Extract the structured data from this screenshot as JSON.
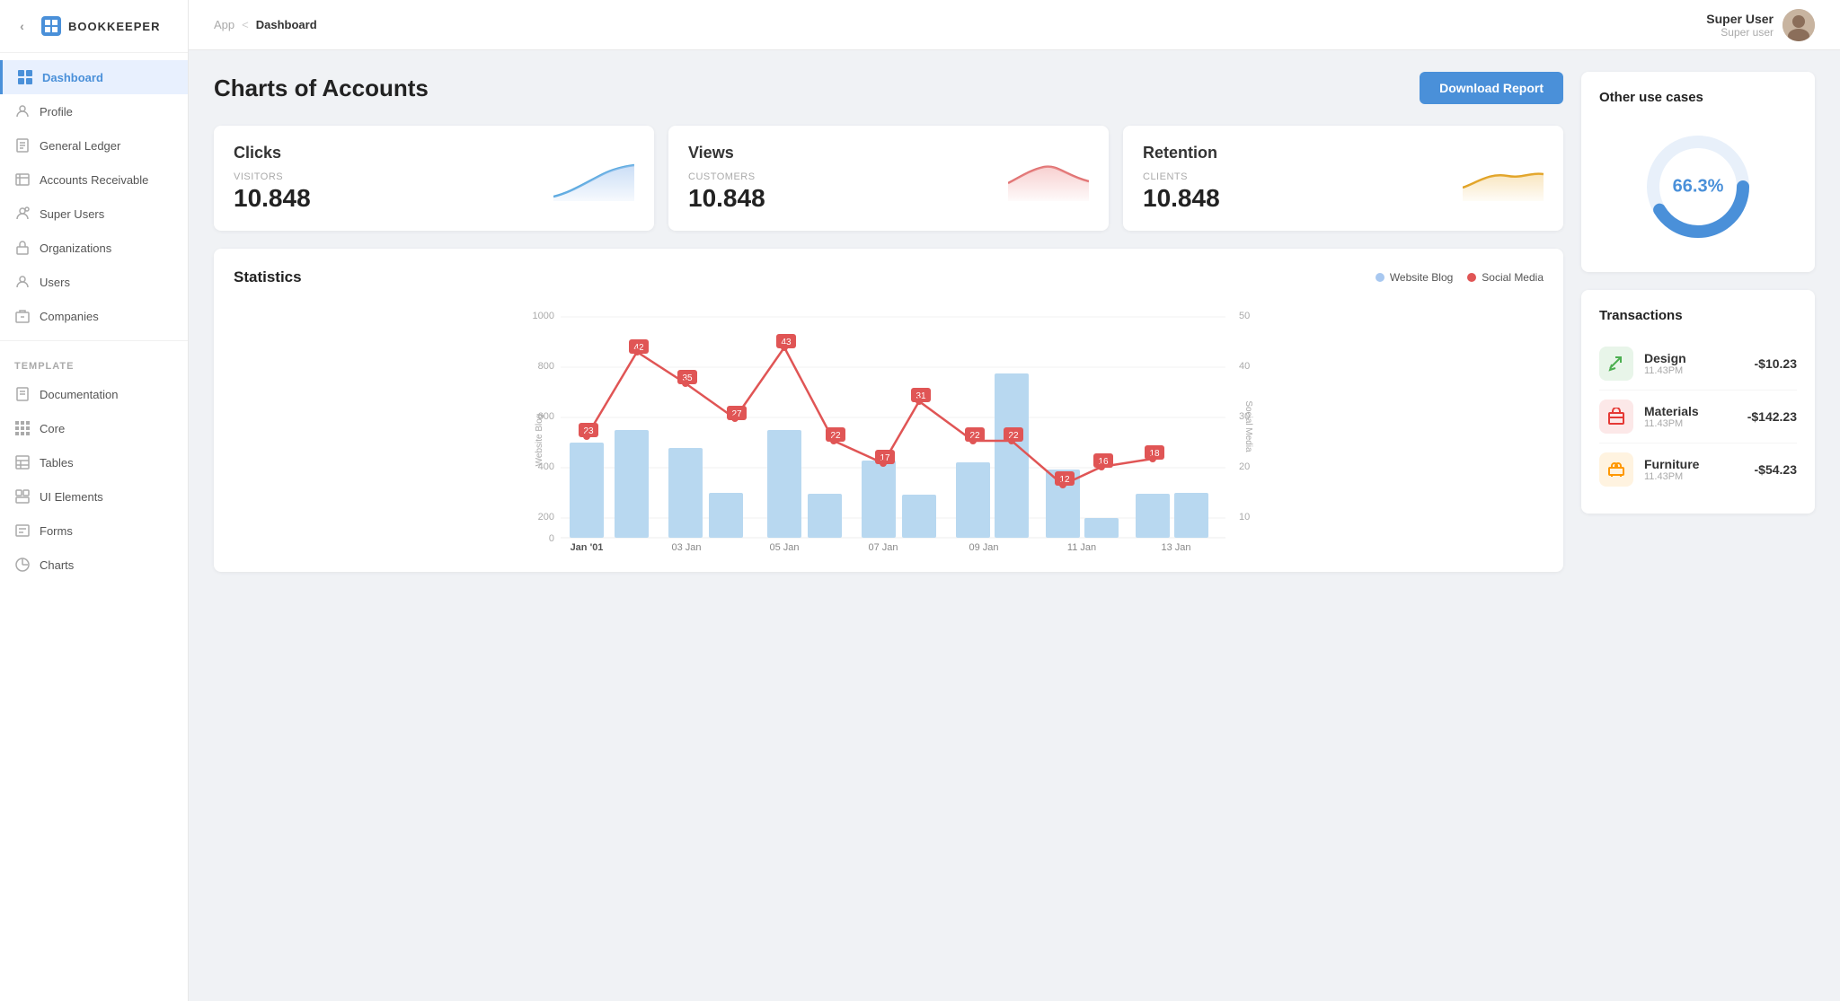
{
  "app": {
    "name": "BOOKKEEPER"
  },
  "user": {
    "name": "Super User",
    "role": "Super user"
  },
  "breadcrumb": {
    "parent": "App",
    "separator": "<",
    "current": "Dashboard"
  },
  "page": {
    "title": "Charts of Accounts",
    "download_button": "Download Report"
  },
  "sidebar": {
    "nav_items": [
      {
        "id": "dashboard",
        "label": "Dashboard",
        "icon": "grid",
        "active": true
      },
      {
        "id": "profile",
        "label": "Profile",
        "icon": "user-circle"
      },
      {
        "id": "general-ledger",
        "label": "General Ledger",
        "icon": "doc"
      },
      {
        "id": "accounts-receivable",
        "label": "Accounts Receivable",
        "icon": "list"
      },
      {
        "id": "super-users",
        "label": "Super Users",
        "icon": "user-settings"
      },
      {
        "id": "organizations",
        "label": "Organizations",
        "icon": "building"
      },
      {
        "id": "users",
        "label": "Users",
        "icon": "user"
      },
      {
        "id": "companies",
        "label": "Companies",
        "icon": "briefcase"
      }
    ],
    "template_label": "TEMPLATE",
    "template_items": [
      {
        "id": "documentation",
        "label": "Documentation",
        "icon": "file"
      },
      {
        "id": "core",
        "label": "Core",
        "icon": "grid-small"
      },
      {
        "id": "tables",
        "label": "Tables",
        "icon": "table"
      },
      {
        "id": "ui-elements",
        "label": "UI Elements",
        "icon": "layers"
      },
      {
        "id": "forms",
        "label": "Forms",
        "icon": "form"
      },
      {
        "id": "charts",
        "label": "Charts",
        "icon": "globe"
      }
    ]
  },
  "stat_cards": [
    {
      "id": "clicks",
      "label": "Clicks",
      "sub_label": "VISITORS",
      "value": "10.848",
      "color": "#a8c8f0",
      "type": "blue"
    },
    {
      "id": "views",
      "label": "Views",
      "sub_label": "CUSTOMERS",
      "value": "10.848",
      "color": "#f0b8b8",
      "type": "red"
    },
    {
      "id": "retention",
      "label": "Retention",
      "sub_label": "CLIENTS",
      "value": "10.848",
      "color": "#f0d080",
      "type": "orange"
    }
  ],
  "statistics": {
    "title": "Statistics",
    "legend": [
      {
        "label": "Website Blog",
        "color": "#a8c8f0"
      },
      {
        "label": "Social Media",
        "color": "#e05555"
      }
    ],
    "x_labels": [
      "Jan '01",
      "03 Jan",
      "05 Jan",
      "07 Jan",
      "09 Jan",
      "11 Jan",
      "13 Jan"
    ],
    "bars": [
      430,
      490,
      410,
      205,
      490,
      200,
      350,
      195,
      340,
      745,
      310,
      90,
      200,
      205
    ],
    "line_points": [
      23,
      42,
      35,
      27,
      43,
      22,
      17,
      31,
      22,
      22,
      12,
      16,
      18
    ],
    "y_left_max": 1000,
    "y_right_max": 50
  },
  "other_use_cases": {
    "title": "Other use cases",
    "percentage": "66.3%"
  },
  "transactions": {
    "title": "Transactions",
    "items": [
      {
        "id": "design",
        "name": "Design",
        "time": "11.43PM",
        "amount": "-$10.23",
        "icon": "✂",
        "bg": "#e8f5e9",
        "color": "#4caf50"
      },
      {
        "id": "materials",
        "name": "Materials",
        "time": "11.43PM",
        "amount": "-$142.23",
        "icon": "⊞",
        "bg": "#fce8e8",
        "color": "#e53935"
      },
      {
        "id": "furniture",
        "name": "Furniture",
        "time": "11.43PM",
        "amount": "-$54.23",
        "icon": "⬛",
        "bg": "#fff3e0",
        "color": "#ff9800"
      }
    ]
  }
}
